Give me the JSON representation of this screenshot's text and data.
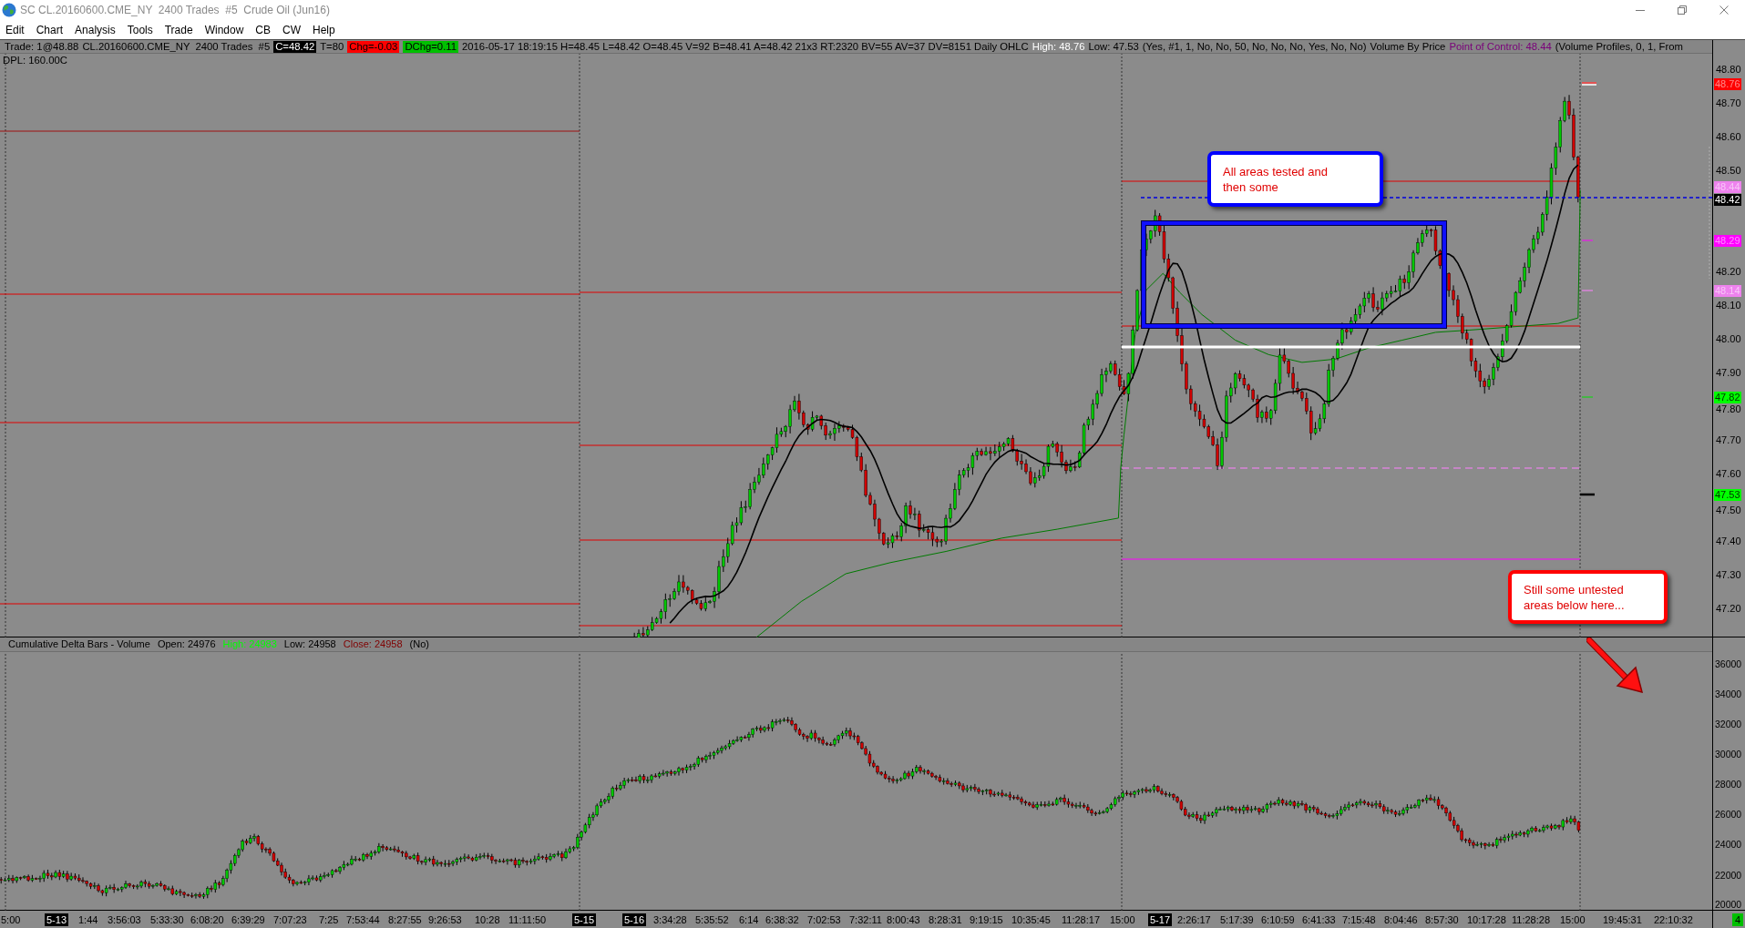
{
  "window": {
    "title": "SC CL.20160600.CME_NY  2400 Trades  #5  Crude Oil (Jun16)"
  },
  "menu": [
    "Edit",
    "Chart",
    "Analysis",
    "Tools",
    "Trade",
    "Window",
    "CB",
    "CW",
    "Help"
  ],
  "price_pane": {
    "info_line": [
      {
        "text": "Trade: 1@48.88",
        "kind": "plain"
      },
      {
        "text": "CL.20160600.CME_NY  2400 Trades  #5",
        "kind": "plain"
      },
      {
        "text": "C=48.42",
        "kind": "boxed",
        "color": "#000000"
      },
      {
        "text": "T=80",
        "kind": "plain"
      },
      {
        "text": "Chg=-0.03",
        "kind": "boxed",
        "color": "#ff0000"
      },
      {
        "text": "DChg=0.11",
        "kind": "boxed",
        "color": "#00c000"
      },
      {
        "text": "2016-05-17 18:19:15 H=48.45 L=48.42 O=48.45 V=92 B=48.41 A=48.42 21x3 RT:2320 BV=55 AV=37 DV=8151 Daily OHLC",
        "kind": "plain"
      },
      {
        "text": "High: 48.76",
        "kind": "colored",
        "color": "#ffffff"
      },
      {
        "text": "Low: 47.53",
        "kind": "plain"
      },
      {
        "text": "(Yes, #1, 1, No, No, 50, No, No, No, Yes, No, No)",
        "kind": "plain"
      },
      {
        "text": "Volume By Price",
        "kind": "plain"
      },
      {
        "text": "Point of Control: 48.44",
        "kind": "colored",
        "color": "#7a007a"
      },
      {
        "text": "(Volume Profiles, 0, 1, From",
        "kind": "plain"
      }
    ],
    "dpl_label": "DPL: 160.00C",
    "annotations": [
      {
        "text": "All areas tested and then some",
        "color": "#0000ff"
      },
      {
        "text": "Still some untested areas below here...",
        "color": "#ff0000"
      }
    ],
    "axis_ticks": [
      "48.80",
      "48.70",
      "48.60",
      "48.50",
      "48.20",
      "48.10",
      "48.00",
      "47.90",
      "47.80",
      "47.70",
      "47.60",
      "47.50",
      "47.40",
      "47.30",
      "47.20"
    ],
    "axis_markers": [
      {
        "label": "48.76",
        "color": "#ff0000"
      },
      {
        "label": "48.44",
        "color": "#ee82ee"
      },
      {
        "label": "48.42",
        "color": "#000000"
      },
      {
        "label": "48.29",
        "color": "#ff00ff"
      },
      {
        "label": "48.14",
        "color": "#ee82ee"
      },
      {
        "label": "47.82",
        "color": "#00ff00"
      },
      {
        "label": "47.53",
        "color": "#00ff00"
      }
    ]
  },
  "delta_pane": {
    "header": [
      {
        "text": "Cumulative Delta Bars - Volume"
      },
      {
        "text": "Open: 24976"
      },
      {
        "text": "High: 24983",
        "color": "#00ff00"
      },
      {
        "text": "Low: 24958"
      },
      {
        "text": "Close: 24958",
        "color": "#800000"
      },
      {
        "text": "(No)"
      }
    ],
    "axis_ticks": [
      "36000",
      "34000",
      "32000",
      "30000",
      "28000",
      "26000",
      "24000",
      "22000",
      "20000"
    ]
  },
  "time_axis": {
    "labels": [
      {
        "text": "5:00",
        "kind": "time"
      },
      {
        "text": "5-13",
        "kind": "date"
      },
      {
        "text": "1:44",
        "kind": "time"
      },
      {
        "text": "3:56:03",
        "kind": "time"
      },
      {
        "text": "5:33:30",
        "kind": "time"
      },
      {
        "text": "6:08:20",
        "kind": "time"
      },
      {
        "text": "6:39:29",
        "kind": "time"
      },
      {
        "text": "7:07:23",
        "kind": "time"
      },
      {
        "text": "7:25",
        "kind": "time"
      },
      {
        "text": "7:53:44",
        "kind": "time"
      },
      {
        "text": "8:27:55",
        "kind": "time"
      },
      {
        "text": "9:26:53",
        "kind": "time"
      },
      {
        "text": "10:28",
        "kind": "time"
      },
      {
        "text": "11:11:50",
        "kind": "time"
      },
      {
        "text": "5-15",
        "kind": "date"
      },
      {
        "text": "5-16",
        "kind": "date"
      },
      {
        "text": "3:34:28",
        "kind": "time"
      },
      {
        "text": "5:35:52",
        "kind": "time"
      },
      {
        "text": "6:14",
        "kind": "time"
      },
      {
        "text": "6:38:32",
        "kind": "time"
      },
      {
        "text": "7:02:53",
        "kind": "time"
      },
      {
        "text": "7:32:11",
        "kind": "time"
      },
      {
        "text": "8:00:43",
        "kind": "time"
      },
      {
        "text": "8:28:31",
        "kind": "time"
      },
      {
        "text": "9:19:15",
        "kind": "time"
      },
      {
        "text": "10:35:45",
        "kind": "time"
      },
      {
        "text": "11:28:17",
        "kind": "time"
      },
      {
        "text": "15:00",
        "kind": "time"
      },
      {
        "text": "5-17",
        "kind": "date"
      },
      {
        "text": "2:26:17",
        "kind": "time"
      },
      {
        "text": "5:17:39",
        "kind": "time"
      },
      {
        "text": "6:10:59",
        "kind": "time"
      },
      {
        "text": "6:41:33",
        "kind": "time"
      },
      {
        "text": "7:15:48",
        "kind": "time"
      },
      {
        "text": "8:04:46",
        "kind": "time"
      },
      {
        "text": "8:57:30",
        "kind": "time"
      },
      {
        "text": "10:17:28",
        "kind": "time"
      },
      {
        "text": "11:28:28",
        "kind": "time"
      },
      {
        "text": "15:00",
        "kind": "time"
      },
      {
        "text": "19:45:31",
        "kind": "time"
      },
      {
        "text": "22:10:32",
        "kind": "time"
      }
    ],
    "bar_counter": "4"
  }
}
